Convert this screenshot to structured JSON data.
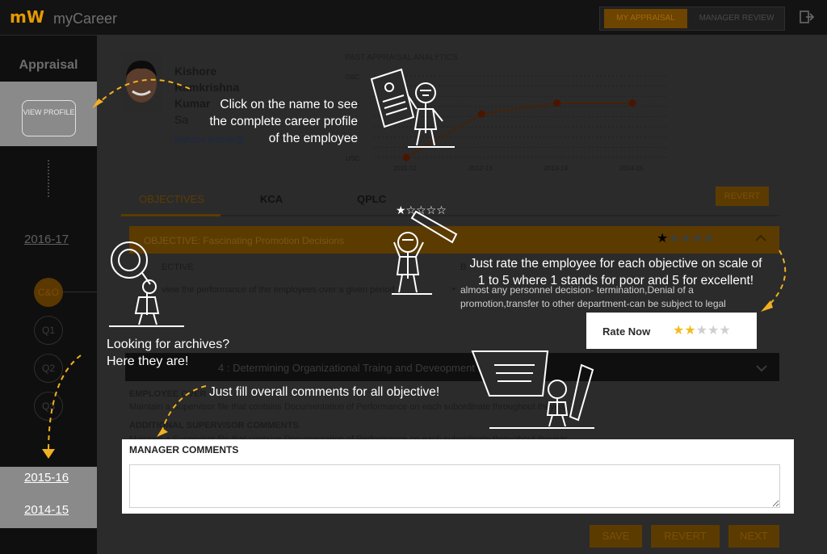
{
  "header": {
    "logo": "mW",
    "app_name": "myCareer",
    "tabs": [
      {
        "label": "MY APPRAISAL"
      },
      {
        "label": "MANAGER REVIEW"
      }
    ]
  },
  "sidebar": {
    "title": "Appraisal",
    "view_profile": "VIEW PROFILE",
    "current_year": "2016-17",
    "quarters": [
      "C&O",
      "Q1",
      "Q2",
      "Q3"
    ],
    "archives": [
      "2015-16",
      "2014-15"
    ]
  },
  "profile": {
    "name_line1": "Kishore",
    "name_line2": "Ramkrishna",
    "name_line3": "Kumar",
    "role_fragment": "Sa",
    "email_fragment": "kishore.kumar@"
  },
  "chart_data": {
    "type": "line",
    "title": "PAST APPRAISAL ANALYTICS",
    "categories": [
      "2011-12",
      "2012-13",
      "2013-14",
      "2014-15"
    ],
    "y_ticks": [
      "USC",
      "ECC",
      "OSC"
    ],
    "values": [
      "USC",
      "ECC-",
      "ECC",
      "ECC"
    ],
    "grid": true
  },
  "content_tabs": [
    "OBJECTIVES",
    "KCA",
    "QPLC"
  ],
  "revert_top": "REVERT",
  "objective1": {
    "title": "OBJECTIVE: Fascinating Promotion Decisions",
    "rating": 1,
    "max_rating": 5,
    "left_heading": "ECTIVE",
    "left_text": "view the performance of the employees over a given period",
    "right_heading": "B",
    "right_bullet": "almost any personnel decision- termination,Denial of a",
    "right_bullet2": "promotion,transfer to other department-can be subject to legal"
  },
  "objective2": {
    "title": "4 : Determining Organizational Traing and Deveopment Needs"
  },
  "employee_section": {
    "heading": "EMPLOYEE OVER",
    "text": "Maintain a Supervisor file that contains Documentation of Performance on each subordinate throughout theyear.",
    "heading2": "ADDITIONAL SUPERVISOR COMMENTS",
    "text2": "Maintain a Supervisor file that contains Documentation of Performance on each subordinate throughout theyear."
  },
  "manager_comments": {
    "label": "MANAGER COMMENTS",
    "value": ""
  },
  "rate_now": {
    "label": "Rate Now",
    "rating": 2,
    "max_rating": 5
  },
  "bottom_buttons": [
    "SAVE",
    "REVERT",
    "NEXT"
  ],
  "tips": {
    "profile": [
      "Click on the name to see",
      "the complete career profile",
      "of the employee"
    ],
    "rate": [
      "Just rate the employee for each objective on scale of",
      "1 to 5 where 1 stands for poor and 5 for excellent!"
    ],
    "archives": [
      "Looking for archives?",
      "Here they are!"
    ],
    "comments": "Just fill overall comments for all  objective!"
  },
  "colors": {
    "accent": "#e69a00",
    "dim_accent": "#5c3b00",
    "star": "#f2bc1b",
    "arrow": "#f0b020"
  }
}
